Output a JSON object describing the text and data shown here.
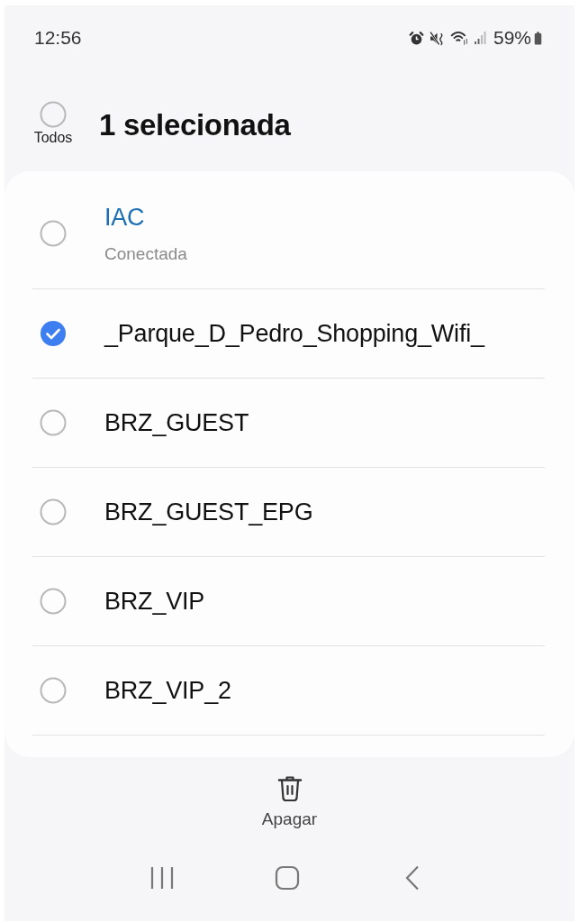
{
  "status_bar": {
    "time": "12:56",
    "battery": "59%"
  },
  "header": {
    "select_all": {
      "label": "Todos",
      "checked": false
    },
    "title": "1 selecionada"
  },
  "networks": [
    {
      "name": "IAC",
      "status": "Conectada",
      "connected": true,
      "selected": false
    },
    {
      "name": "_Parque_D_Pedro_Shopping_Wifi_",
      "connected": false,
      "selected": true
    },
    {
      "name": "BRZ_GUEST",
      "connected": false,
      "selected": false
    },
    {
      "name": "BRZ_GUEST_EPG",
      "connected": false,
      "selected": false
    },
    {
      "name": "BRZ_VIP",
      "connected": false,
      "selected": false
    },
    {
      "name": "BRZ_VIP_2",
      "connected": false,
      "selected": false
    }
  ],
  "actions": [
    {
      "kind": "delete",
      "label": "Apagar"
    }
  ]
}
